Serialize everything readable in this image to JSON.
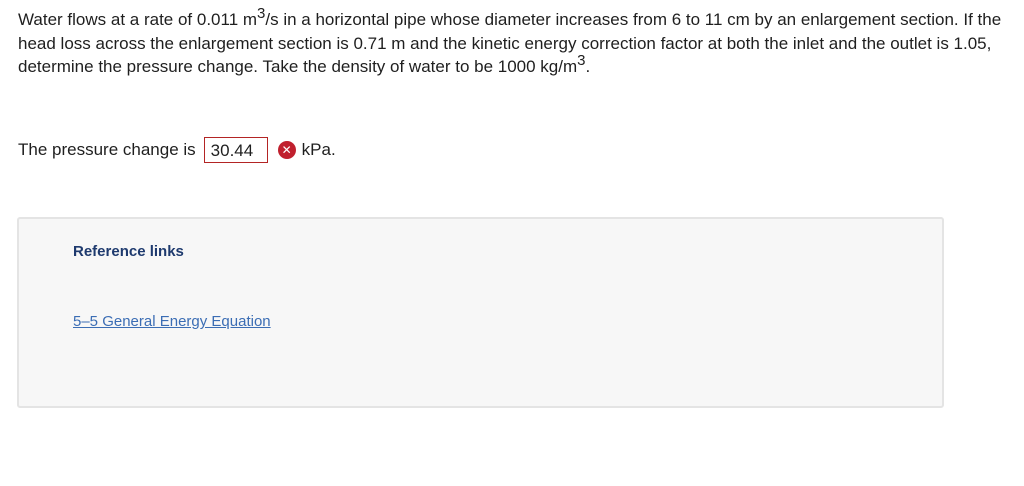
{
  "question": {
    "part1": "Water flows at a rate of 0.011 m",
    "sup1": "3",
    "part2": "/s in a horizontal pipe whose diameter increases from 6 to 11 cm by an enlargement section. If the head loss across the enlargement section is 0.71 m and the kinetic energy correction factor at both the inlet and the outlet is 1.05, determine the pressure change. Take the density of water to be 1000 kg/m",
    "sup2": "3",
    "part3": "."
  },
  "answer": {
    "prefix": "The pressure change is",
    "value": "30.44",
    "status_icon": "incorrect-x-icon",
    "unit": "kPa."
  },
  "references": {
    "title": "Reference links",
    "links": [
      {
        "label": "5–5 General Energy Equation"
      }
    ]
  },
  "colors": {
    "error_red": "#c0202e",
    "link_blue": "#3b6db4",
    "title_navy": "#1e3a6e"
  }
}
